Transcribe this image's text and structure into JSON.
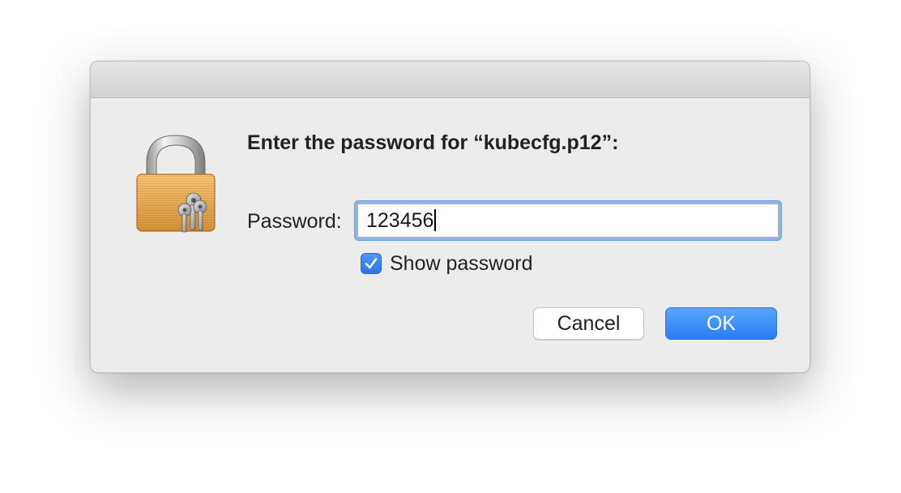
{
  "dialog": {
    "prompt": "Enter the password for “kubecfg.p12”:",
    "password_label": "Password:",
    "password_value": "123456",
    "show_password_label": "Show password",
    "show_password_checked": true,
    "cancel_label": "Cancel",
    "ok_label": "OK",
    "icon": "keychain-lock-icon",
    "accent_color": "#2f7cf6"
  }
}
